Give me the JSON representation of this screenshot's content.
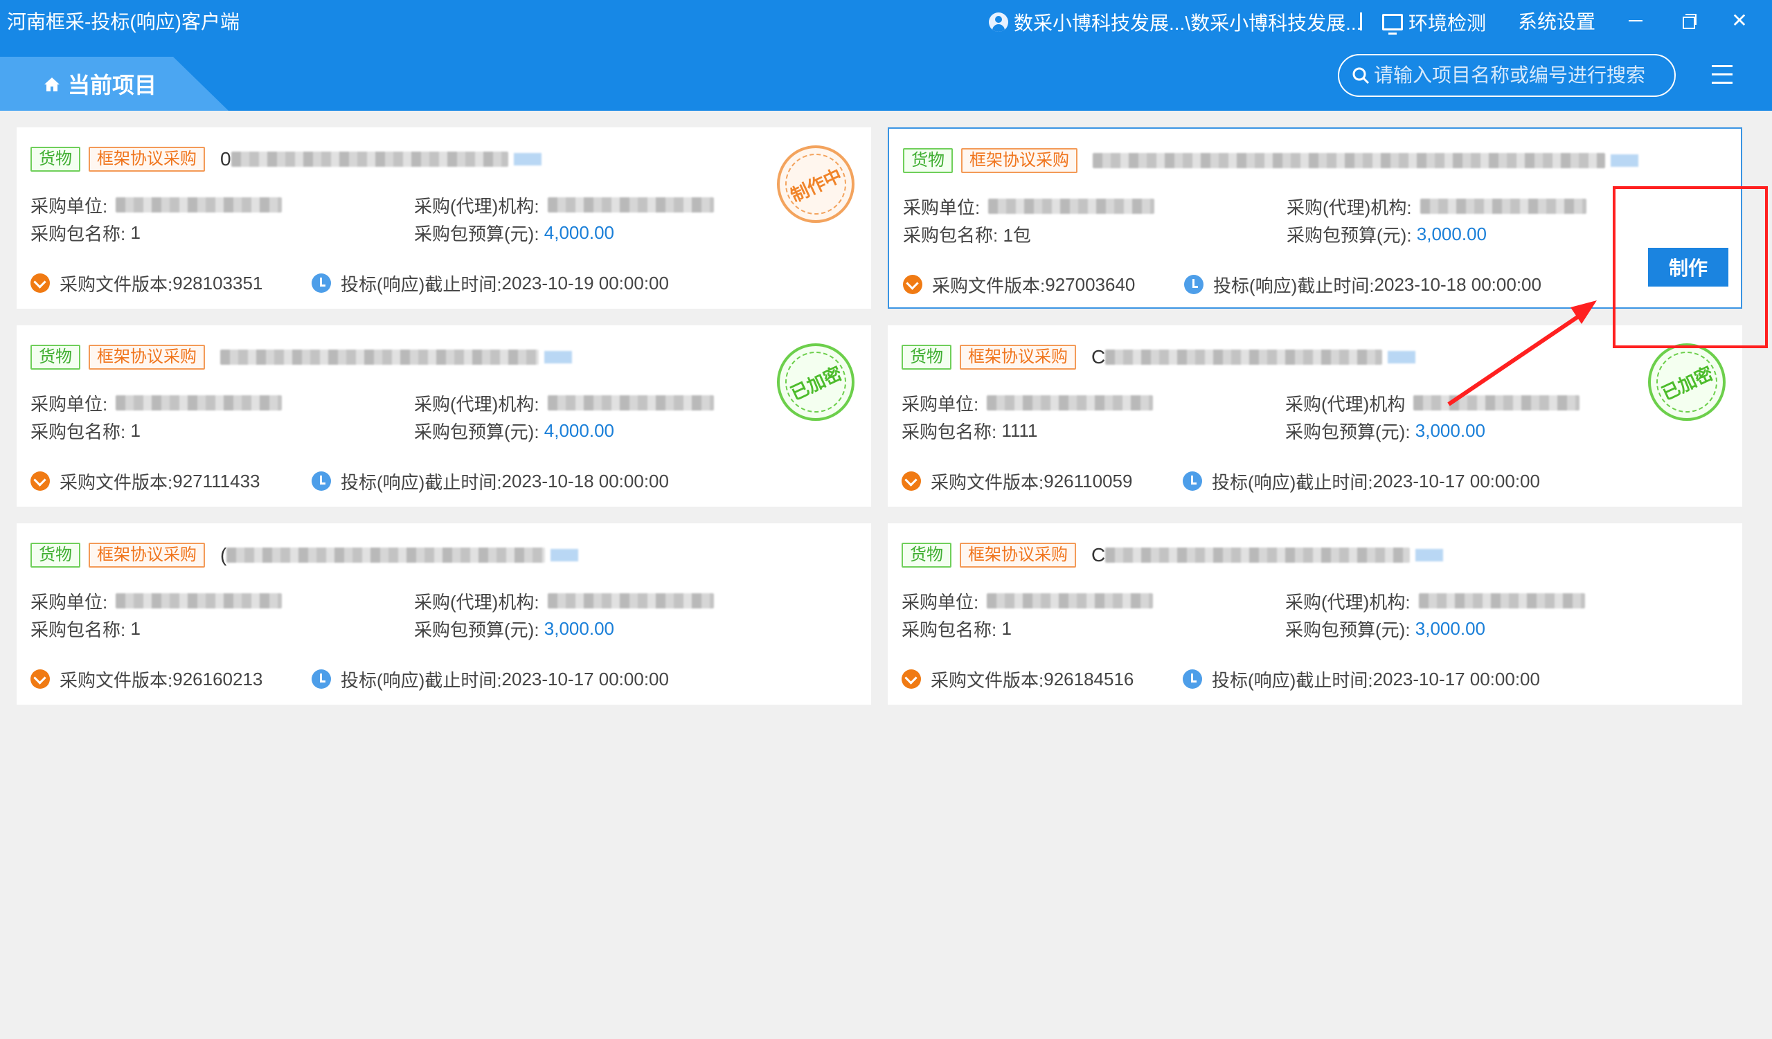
{
  "window": {
    "title": "河南框采-投标(响应)客户端",
    "user_label": "数采小博科技发展...\\数采小博科技发展...",
    "env_check": "环境检测",
    "settings": "系统设置",
    "close_glyph": "✕"
  },
  "header": {
    "tab_label": "当前项目",
    "search_placeholder": "请输入项目名称或编号进行搜索"
  },
  "labels": {
    "unit": "采购单位:",
    "agency": "采购(代理)机构:",
    "agency_nocolon": "采购(代理)机构",
    "package_name": "采购包名称:",
    "budget": "采购包预算(元):",
    "version_prefix": "采购文件版本:",
    "deadline_prefix": "投标(响应)截止时间:"
  },
  "projects": [
    {
      "tag_type": "货物",
      "tag_method": "框架协议采购",
      "name_prefix": "0",
      "package": "1",
      "budget": "4,000.00",
      "version": "928103351",
      "deadline": "2023-10-19 00:00:00",
      "stamp": "制作中",
      "stamp_color": "#f0842a"
    },
    {
      "tag_type": "货物",
      "tag_method": "框架协议采购",
      "name_prefix": "",
      "package": "1包",
      "budget": "3,000.00",
      "version": "927003640",
      "deadline": "2023-10-18 00:00:00",
      "action": "制作",
      "selected": true
    },
    {
      "tag_type": "货物",
      "tag_method": "框架协议采购",
      "name_prefix": "",
      "package": "1",
      "budget": "4,000.00",
      "version": "927111433",
      "deadline": "2023-10-18 00:00:00",
      "stamp": "已加密",
      "stamp_color": "#4cbc2b"
    },
    {
      "tag_type": "货物",
      "tag_method": "框架协议采购",
      "name_prefix": "C",
      "package": "1111",
      "budget": "3,000.00",
      "version": "926110059",
      "deadline": "2023-10-17 00:00:00",
      "stamp": "已加密",
      "stamp_color": "#4cbc2b"
    },
    {
      "tag_type": "货物",
      "tag_method": "框架协议采购",
      "name_prefix": "(",
      "package": "1",
      "budget": "3,000.00",
      "version": "926160213",
      "deadline": "2023-10-17 00:00:00"
    },
    {
      "tag_type": "货物",
      "tag_method": "框架协议采购",
      "name_prefix": "C",
      "package": "1",
      "budget": "3,000.00",
      "version": "926184516",
      "deadline": "2023-10-17 00:00:00"
    }
  ]
}
